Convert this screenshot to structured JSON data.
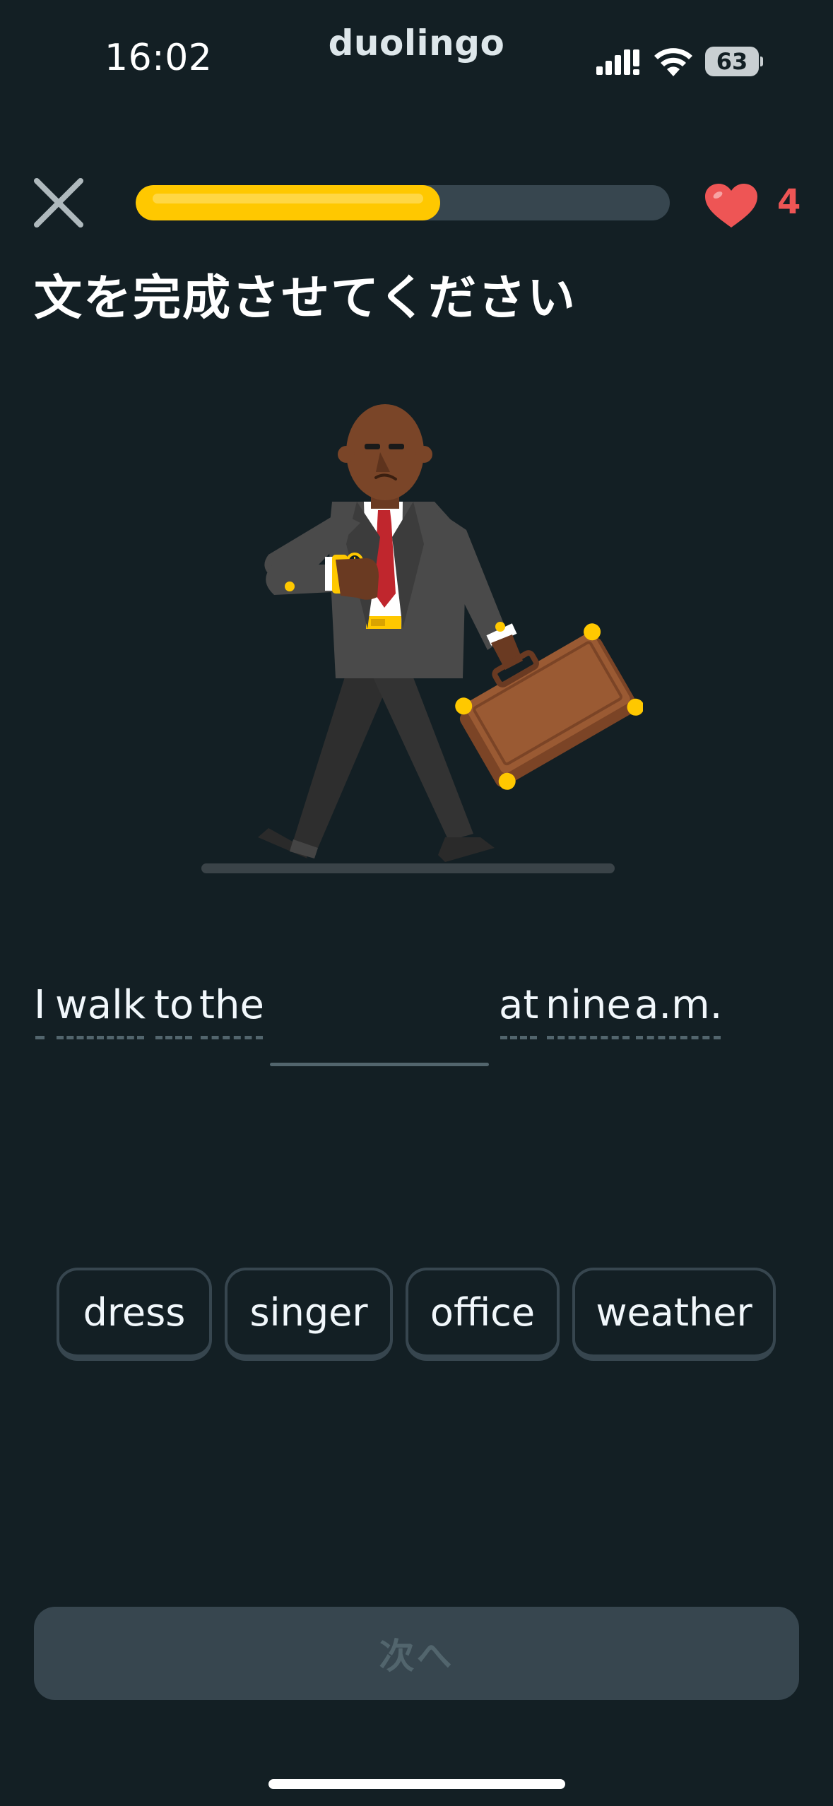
{
  "status_bar": {
    "time": "16:02",
    "brand": "duolingo",
    "battery": "63",
    "icons": [
      "signal-icon",
      "wifi-icon",
      "battery-icon"
    ]
  },
  "header": {
    "close_icon": "close-icon",
    "progress": 0.57,
    "hearts": "4",
    "heart_icon": "heart-icon"
  },
  "title": "文を完成させてください",
  "illustration": {
    "name": "businessman-checking-watch-with-briefcase"
  },
  "sentence": {
    "before": [
      "I",
      "walk",
      "to",
      "the"
    ],
    "after": [
      "at",
      "nine",
      "a.m."
    ]
  },
  "choices": [
    "dress",
    "singer",
    "office",
    "weather"
  ],
  "next_label": "次へ",
  "colors": {
    "background": "#131f24",
    "progress_fill": "#ffc800",
    "progress_track": "#37464f",
    "heart": "#ee5555",
    "chip_border": "#37464f",
    "disabled_button": "#37464f",
    "disabled_text": "#52656d"
  }
}
